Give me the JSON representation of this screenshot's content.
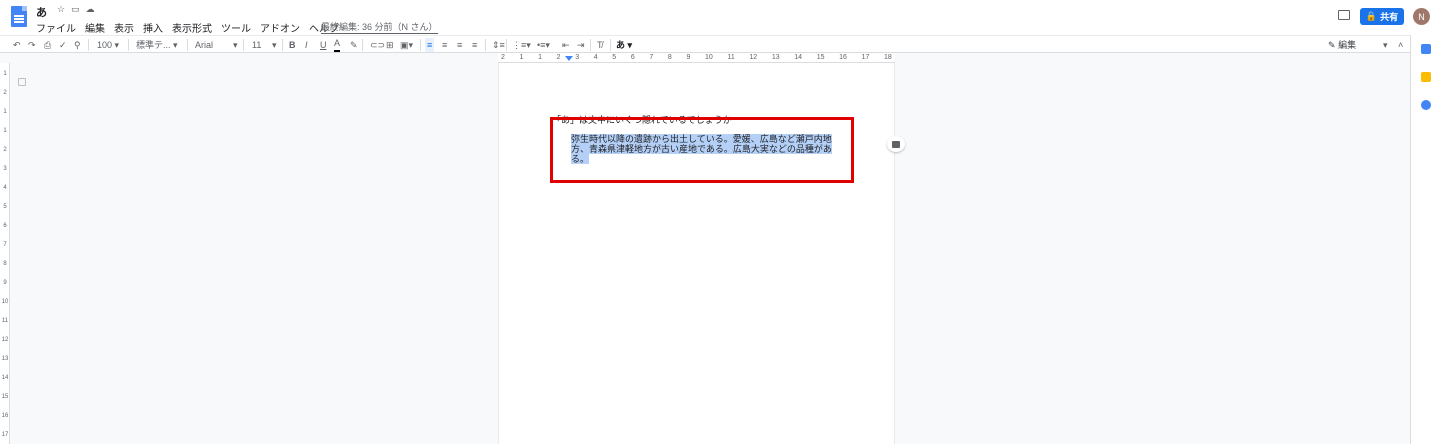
{
  "document": {
    "title": "あ",
    "last_edit": "最終編集: 36 分前（N さん）"
  },
  "menu": [
    "ファイル",
    "編集",
    "表示",
    "挿入",
    "表示形式",
    "ツール",
    "アドオン",
    "ヘルプ"
  ],
  "share_label": "共有",
  "avatar_initial": "N",
  "toolbar": {
    "zoom": "100",
    "style": "標準テ...",
    "font": "Arial",
    "size": "11",
    "mode": "編集"
  },
  "ruler_numbers": [
    "2",
    "1",
    "1",
    "2",
    "3",
    "4",
    "5",
    "6",
    "7",
    "8",
    "9",
    "10",
    "11",
    "12",
    "13",
    "14",
    "15",
    "16",
    "17",
    "18"
  ],
  "vruler_numbers": [
    "1",
    "2",
    "1",
    "1",
    "2",
    "3",
    "4",
    "5",
    "6",
    "7",
    "8",
    "9",
    "10",
    "11",
    "12",
    "13",
    "14",
    "15",
    "16",
    "17"
  ],
  "content": {
    "heading": "「あ」は文中にいくつ隠れているでしょうか",
    "paragraph": "弥生時代以降の遺跡から出土している。愛媛、広島など瀬戸内地方、青森県津軽地方が古い産地である。広島大実などの品種がある。"
  },
  "colors": {
    "accent": "#1a73e8",
    "highlight": "#b4d0f7",
    "annotation_box": "#e00000"
  },
  "icons": [
    "docs-icon",
    "star-icon",
    "folder-icon",
    "cloud-icon",
    "comment-icon",
    "lock-icon",
    "undo-icon",
    "redo-icon",
    "print-icon",
    "spellcheck-icon",
    "paint-format-icon",
    "bold-icon",
    "italic-icon",
    "underline-icon",
    "text-color-icon",
    "highlight-icon",
    "link-icon",
    "add-comment-icon",
    "image-icon",
    "align-left-icon",
    "align-center-icon",
    "align-right-icon",
    "justify-icon",
    "line-spacing-icon",
    "numbered-list-icon",
    "bulleted-list-icon",
    "decrease-indent-icon",
    "increase-indent-icon",
    "clear-format-icon",
    "input-tools-icon",
    "pencil-icon",
    "collapse-icon"
  ]
}
